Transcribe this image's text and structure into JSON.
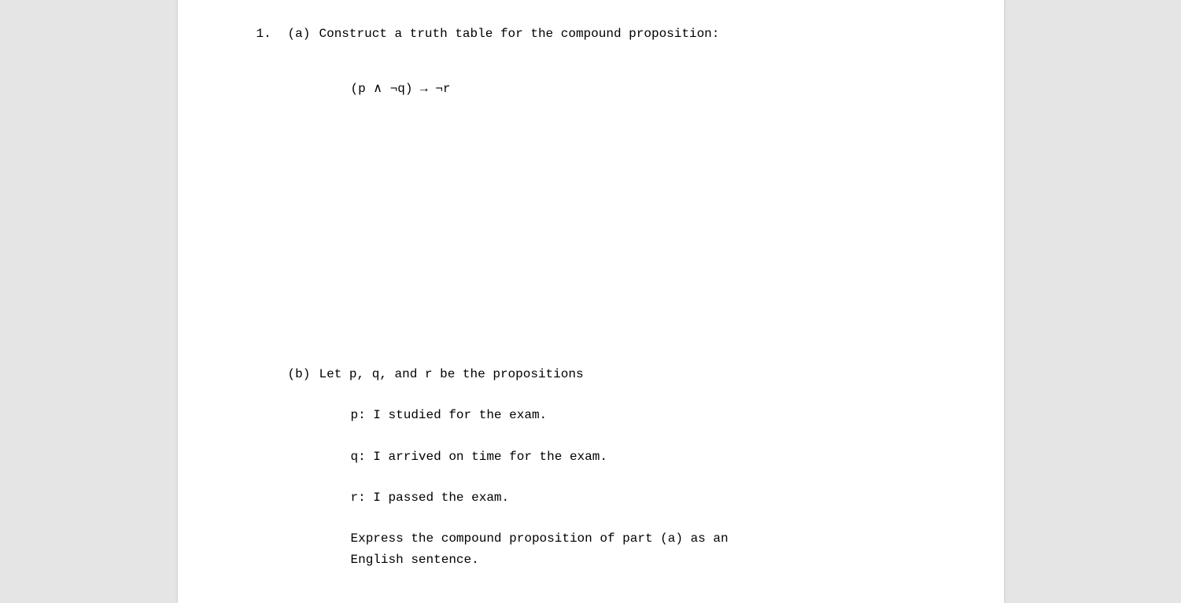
{
  "problem": {
    "number": "1.",
    "partA": {
      "label": "(a)",
      "prompt": "Construct a truth table for the compound proposition:",
      "formula": "(p ∧ ¬q) → ¬r"
    },
    "partB": {
      "label": "(b)",
      "intro": "Let p, q, and r be the propositions",
      "defs": {
        "p": "p: I studied for the exam.",
        "q": "q: I arrived on time for the exam.",
        "r": "r: I passed the exam."
      },
      "instruction_line1": "Express the compound proposition of part (a) as an",
      "instruction_line2": "English sentence."
    }
  }
}
